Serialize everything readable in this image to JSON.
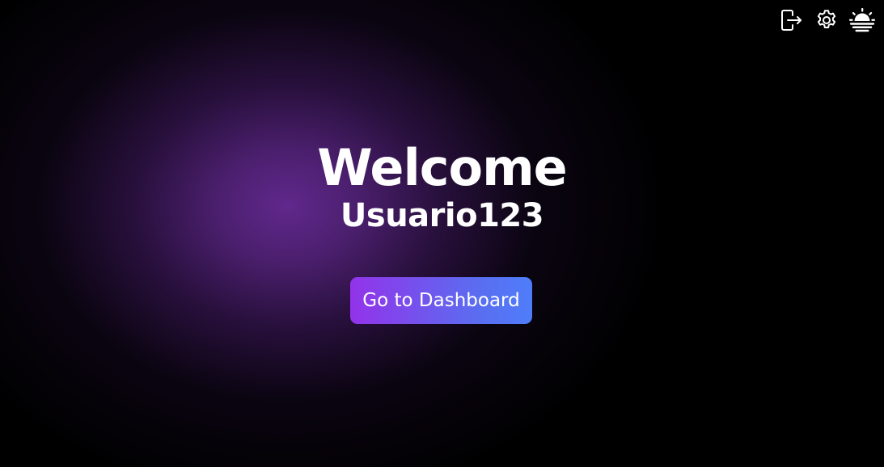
{
  "toolbar": {
    "icons": [
      {
        "name": "logout-icon"
      },
      {
        "name": "gear-icon"
      },
      {
        "name": "sunrise-icon"
      }
    ]
  },
  "hero": {
    "title": "Welcome",
    "username": "Usuario123"
  },
  "cta": {
    "label": "Go to Dashboard"
  },
  "colors": {
    "background": "#000000",
    "glow": "#60288c",
    "button_start": "#9333ea",
    "button_end": "#4f7dfa",
    "text": "#ffffff"
  }
}
